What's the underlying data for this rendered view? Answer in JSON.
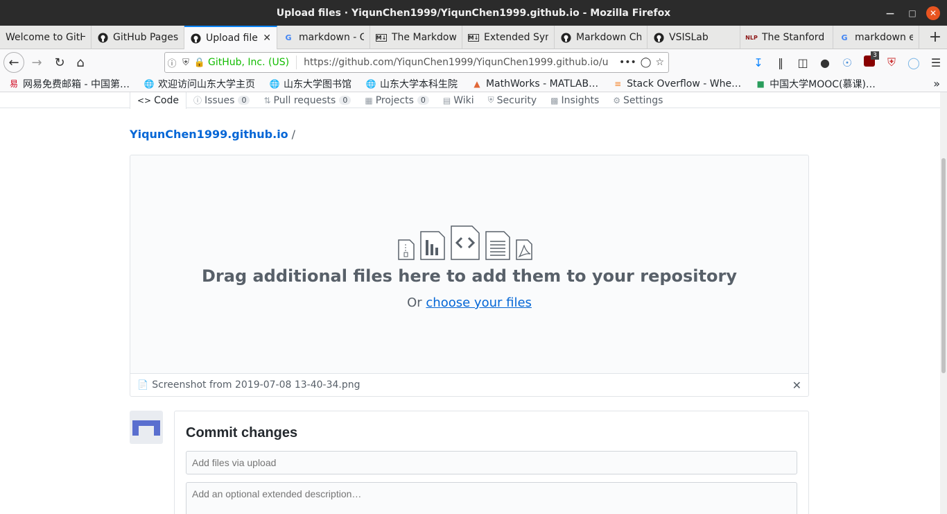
{
  "window": {
    "title": "Upload files · YiqunChen1999/YiqunChen1999.github.io - Mozilla Firefox"
  },
  "tabs": [
    {
      "label": "Welcome to GitH",
      "icon": "github-icon",
      "active": false
    },
    {
      "label": "GitHub Pages",
      "icon": "github-icon",
      "active": false
    },
    {
      "label": "Upload file",
      "icon": "github-icon",
      "active": true
    },
    {
      "label": "markdown - G",
      "icon": "google-icon",
      "active": false
    },
    {
      "label": "The Markdow",
      "icon": "markdown-icon",
      "active": false
    },
    {
      "label": "Extended Syn",
      "icon": "markdown-icon",
      "active": false
    },
    {
      "label": "Markdown Ch",
      "icon": "github-icon",
      "active": false
    },
    {
      "label": "VSISLab",
      "icon": "github-icon",
      "active": false
    },
    {
      "label": "The Stanford",
      "icon": "nlp-icon",
      "active": false
    },
    {
      "label": "markdown ex",
      "icon": "google-icon",
      "active": false
    }
  ],
  "nav": {
    "identity": "GitHub, Inc. (US)",
    "url": "https://github.com/YiqunChen1999/YiqunChen1999.github.io/u",
    "more": "•••",
    "badge": "3"
  },
  "bookmarks": [
    {
      "label": "网易免费邮箱 - 中国第…",
      "icon": "netease-icon"
    },
    {
      "label": "欢迎访问山东大学主页",
      "icon": "globe-icon"
    },
    {
      "label": "山东大学图书馆",
      "icon": "globe-icon"
    },
    {
      "label": "山东大学本科生院",
      "icon": "globe-icon"
    },
    {
      "label": "MathWorks - MATLAB…",
      "icon": "matlab-icon"
    },
    {
      "label": "Stack Overflow - Whe…",
      "icon": "stackoverflow-icon"
    },
    {
      "label": "中国大学MOOC(慕课)…",
      "icon": "mooc-icon"
    }
  ],
  "reponav": {
    "code": "Code",
    "issues": "Issues",
    "issues_count": "0",
    "pulls": "Pull requests",
    "pulls_count": "0",
    "projects": "Projects",
    "projects_count": "0",
    "wiki": "Wiki",
    "security": "Security",
    "insights": "Insights",
    "settings": "Settings"
  },
  "breadcrumb": {
    "repo": "YiqunChen1999.github.io",
    "separator": "/"
  },
  "dropzone": {
    "title": "Drag additional files here to add them to your repository",
    "or": "Or",
    "link": "choose your files"
  },
  "uploaded_file": {
    "name": "Screenshot from 2019-07-08 13-40-34.png"
  },
  "commit": {
    "title": "Commit changes",
    "summary_placeholder": "Add files via upload",
    "description_placeholder": "Add an optional extended description…"
  }
}
